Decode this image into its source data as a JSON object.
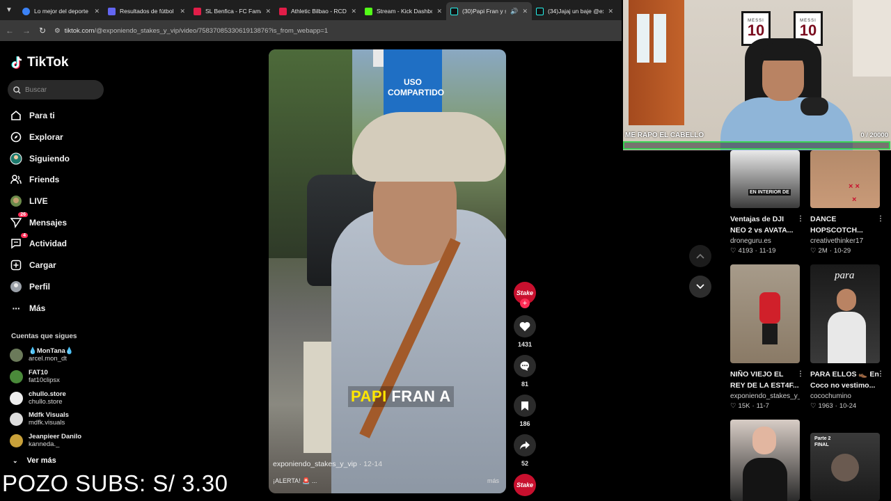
{
  "browser": {
    "tabs": [
      {
        "title": "Lo mejor del deporte",
        "color": "#3b82f6"
      },
      {
        "title": "Resultados de fútbol",
        "color": "#6366f1"
      },
      {
        "title": "SL Benfica - FC Famal",
        "color": "#e11d48"
      },
      {
        "title": "Athletic Bilbao - RCD",
        "color": "#e11d48"
      },
      {
        "title": "Stream - Kick Dashbo",
        "color": "#53fc18"
      },
      {
        "title": "(30)Papi Fran y su",
        "color": "#111111"
      },
      {
        "title": "(34)Jajaj un baje @ex",
        "color": "#111111"
      }
    ],
    "url_host": "tiktok.com",
    "url_path": "/@exponiendo_stakes_y_vip/video/7583708533061913876?is_from_webapp=1"
  },
  "tiktok": {
    "logo": "TikTok",
    "search_placeholder": "Buscar",
    "nav": [
      {
        "label": "Para ti",
        "icon": "home-icon"
      },
      {
        "label": "Explorar",
        "icon": "compass-icon"
      },
      {
        "label": "Siguiendo",
        "icon": "following-icon"
      },
      {
        "label": "Friends",
        "icon": "friends-icon"
      },
      {
        "label": "LIVE",
        "icon": "live-icon"
      },
      {
        "label": "Mensajes",
        "icon": "messages-icon",
        "badge": "26"
      },
      {
        "label": "Actividad",
        "icon": "activity-icon",
        "badge": "4"
      },
      {
        "label": "Cargar",
        "icon": "upload-icon"
      },
      {
        "label": "Perfil",
        "icon": "profile-icon"
      },
      {
        "label": "Más",
        "icon": "more-icon"
      }
    ],
    "following_title": "Cuentas que sigues",
    "following": [
      {
        "name": "💧MonTana💧",
        "handle": "arcel.mon_dt",
        "color": "#6b7a5a"
      },
      {
        "name": "FAT10",
        "handle": "fat10clipsx",
        "color": "#4a8a3a"
      },
      {
        "name": "chullo.store",
        "handle": "chullo.store",
        "color": "#eeeeee"
      },
      {
        "name": "Mdfk Visuals",
        "handle": "mdfk.visuals",
        "color": "#dddddd"
      },
      {
        "name": "Jeanpieer Danilo",
        "handle": "kanneda._",
        "color": "#c9a13a"
      }
    ],
    "see_more": "Ver más"
  },
  "overlay": {
    "pozo": "POZO SUBS: S/ 3.30",
    "goal_label": "ME RAPO EL CABELLO",
    "goal_count": "0 / 20000",
    "goal_progress": 0,
    "frames": [
      {
        "label": "MESSI",
        "num": "10"
      },
      {
        "label": "MESSI",
        "num": "10"
      }
    ]
  },
  "video": {
    "caption_first": "PAPI",
    "caption_rest": " FRAN A",
    "author": "exponiendo_stakes_y_vip",
    "date": "· 12-14",
    "desc": "¡ALERTA! 🚨 ...",
    "more": "más",
    "sign_text": "USO COMPARTIDO",
    "creator_avatar": "Stake",
    "likes": "1431",
    "comments": "81",
    "saves": "186",
    "shares": "52"
  },
  "recommendations": [
    {
      "title": "Ventajas de DJI NEO 2 vs AVATA...",
      "author": "droneguru.es",
      "views": "4193",
      "date": "11-19",
      "thumb_text": "EN INTERIOR DE",
      "colors": [
        "#e9e9e9",
        "#3b3b3b"
      ]
    },
    {
      "title": "DANCE HOPSCOTCH...",
      "author": "creativethinker17",
      "views": "2M",
      "date": "10-29",
      "thumb_text": "",
      "colors": [
        "#b48a6a",
        "#c99a78"
      ]
    },
    {
      "title": "NIÑO VIEJO EL REY DE LA EST4F...",
      "author": "exponiendo_stakes_y_...",
      "views": "15K",
      "date": "11-7",
      "thumb_text": "",
      "colors": [
        "#a79b8a",
        "#8a7a66"
      ]
    },
    {
      "title": "PARA ELLOS 👞 En Coco no vestimo...",
      "author": "cocochumino",
      "views": "1963",
      "date": "10-24",
      "thumb_text": "para",
      "colors": [
        "#1a1a1a",
        "#3a3a3a"
      ]
    },
    {
      "title": "",
      "author": "",
      "views": "",
      "date": "",
      "thumb_text": "",
      "colors": [
        "#d8cdc6",
        "#2a2a2a"
      ]
    },
    {
      "title": "",
      "author": "",
      "views": "",
      "date": "",
      "thumb_text": "Parte 2 FINAL",
      "colors": [
        "#3a3a3a",
        "#1a1a1a"
      ]
    }
  ]
}
